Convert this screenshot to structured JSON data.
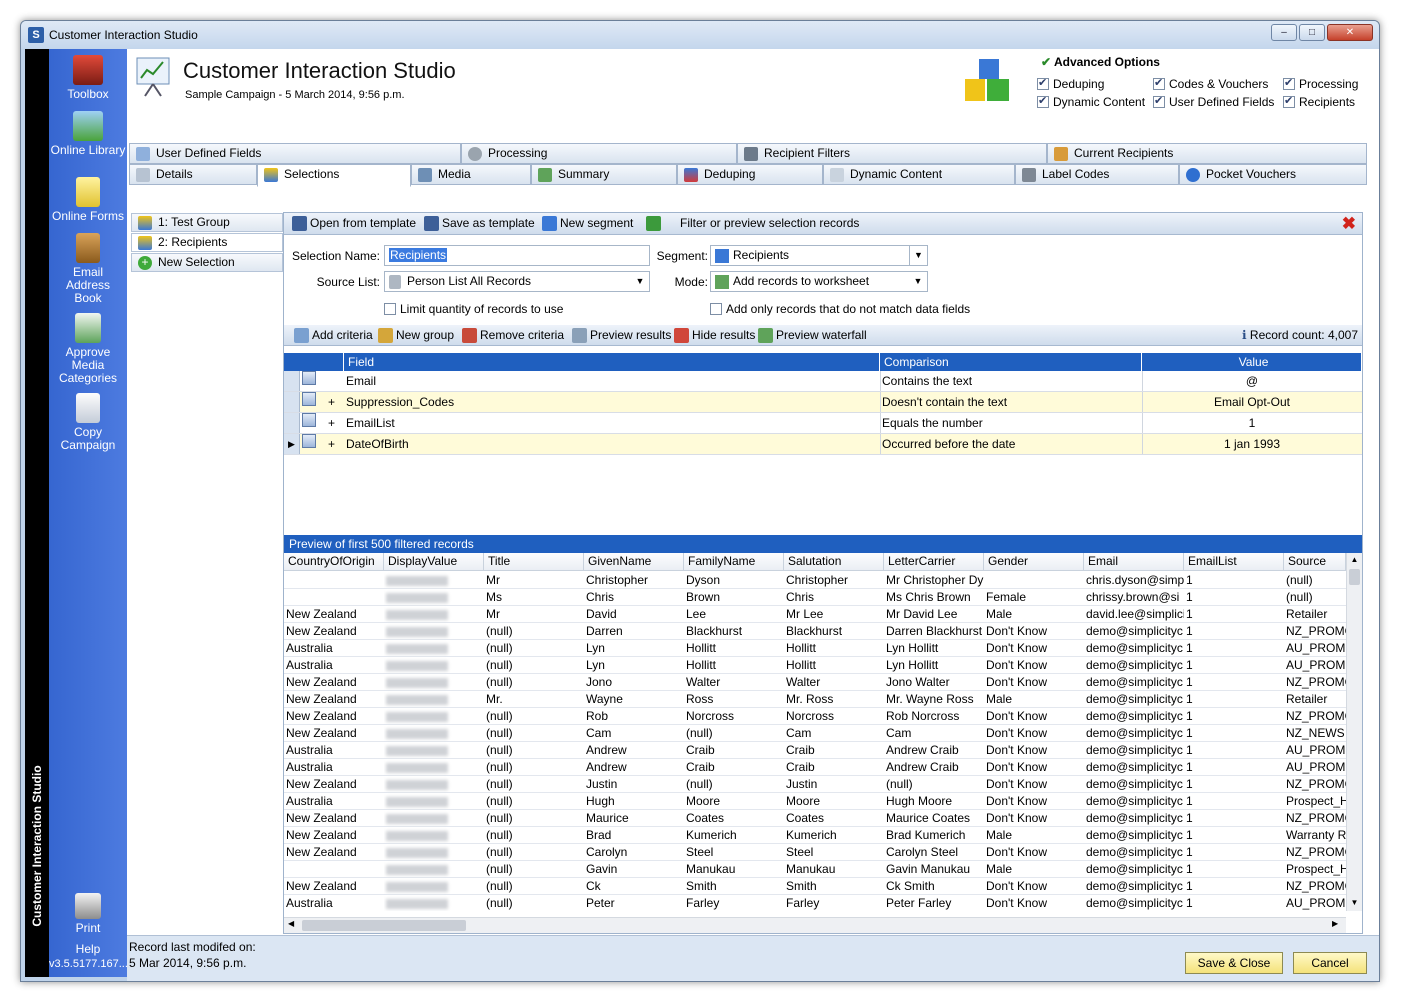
{
  "window": {
    "title": "Customer Interaction Studio"
  },
  "sidebar": {
    "vertical_title": "Customer Interaction Studio",
    "items": [
      "Toolbox",
      "Online Library",
      "Online Forms",
      "Email Address Book",
      "Approve Media Categories",
      "Copy Campaign"
    ],
    "print": "Print",
    "help": "Help",
    "version": "v3.5.5177.167..."
  },
  "header": {
    "title": "Customer Interaction Studio",
    "subtitle": "Sample Campaign - 5 March 2014, 9:56 p.m."
  },
  "advanced": {
    "title": "Advanced Options",
    "options": [
      {
        "label": "Deduping",
        "checked": true
      },
      {
        "label": "Codes & Vouchers",
        "checked": true
      },
      {
        "label": "Processing",
        "checked": true
      },
      {
        "label": "Dynamic Content",
        "checked": true
      },
      {
        "label": "User Defined Fields",
        "checked": true
      },
      {
        "label": "Recipients",
        "checked": true
      }
    ]
  },
  "tabs_top": [
    "User Defined Fields",
    "Processing",
    "Recipient Filters",
    "Current Recipients"
  ],
  "tabs_bottom": [
    "Details",
    "Selections",
    "Media",
    "Summary",
    "Deduping",
    "Dynamic Content",
    "Label Codes",
    "Pocket Vouchers"
  ],
  "selections": [
    "1: Test Group",
    "2: Recipients",
    "New Selection"
  ],
  "toolbar1": {
    "open": "Open from template",
    "save": "Save as template",
    "segment": "New segment",
    "filter": "Filter or preview selection records"
  },
  "form": {
    "name_label": "Selection Name:",
    "name_value": "Recipients",
    "segment_label": "Segment:",
    "segment_value": "Recipients",
    "source_label": "Source List:",
    "source_value": "Person List All Records",
    "mode_label": "Mode:",
    "mode_value": "Add records to worksheet",
    "limit_label": "Limit quantity of records to use",
    "only_label": "Add only records that do not match data fields"
  },
  "toolbar2": {
    "add": "Add criteria",
    "group": "New group",
    "remove": "Remove criteria",
    "preview": "Preview results",
    "hide": "Hide results",
    "waterfall": "Preview waterfall",
    "count": "Record count: 4,007"
  },
  "criteria": {
    "headers": [
      "Field",
      "Comparison",
      "Value"
    ],
    "rows": [
      {
        "plus": "",
        "field": "Email",
        "comparison": "Contains the text",
        "value": "@"
      },
      {
        "plus": "+",
        "field": "Suppression_Codes",
        "comparison": "Doesn't contain the text",
        "value": "Email Opt-Out"
      },
      {
        "plus": "+",
        "field": "EmailList",
        "comparison": "Equals the number",
        "value": "1"
      },
      {
        "plus": "+",
        "field": "DateOfBirth",
        "comparison": "Occurred before the date",
        "value": "1 jan 1993"
      }
    ]
  },
  "preview": {
    "title": "Preview of first 500 filtered records",
    "headers": [
      "CountryOfOrigin",
      "DisplayValue",
      "Title",
      "GivenName",
      "FamilyName",
      "Salutation",
      "LetterCarrier",
      "Gender",
      "Email",
      "EmailList",
      "Source"
    ],
    "rows": [
      [
        "",
        "",
        "Mr",
        "Christopher",
        "Dyson",
        "Christopher",
        "Mr Christopher Dy",
        "",
        "chris.dyson@simp",
        "1",
        "(null)"
      ],
      [
        "",
        "",
        "Ms",
        "Chris",
        "Brown",
        "Chris",
        "Ms Chris Brown",
        "Female",
        "chrissy.brown@si",
        "1",
        "(null)"
      ],
      [
        "New Zealand",
        "",
        "Mr",
        "David",
        "Lee",
        "Mr Lee",
        "Mr David Lee",
        "Male",
        "david.lee@simplici",
        "1",
        "Retailer"
      ],
      [
        "New Zealand",
        "",
        "(null)",
        "Darren",
        "Blackhurst",
        "Blackhurst",
        "Darren Blackhurst",
        "Don't Know",
        "demo@simplicityc",
        "1",
        "NZ_PROMC"
      ],
      [
        "Australia",
        "",
        "(null)",
        "Lyn",
        "Hollitt",
        "Hollitt",
        "Lyn Hollitt",
        "Don't Know",
        "demo@simplicityc",
        "1",
        "AU_PROMC"
      ],
      [
        "Australia",
        "",
        "(null)",
        "Lyn",
        "Hollitt",
        "Hollitt",
        "Lyn Hollitt",
        "Don't Know",
        "demo@simplicityc",
        "1",
        "AU_PROMC"
      ],
      [
        "New Zealand",
        "",
        "(null)",
        "Jono",
        "Walter",
        "Walter",
        "Jono Walter",
        "Don't Know",
        "demo@simplicityc",
        "1",
        "NZ_PROMC"
      ],
      [
        "New Zealand",
        "",
        "Mr.",
        "Wayne",
        "Ross",
        "Mr. Ross",
        "Mr. Wayne Ross",
        "Male",
        "demo@simplicityc",
        "1",
        "Retailer"
      ],
      [
        "New Zealand",
        "",
        "(null)",
        "Rob",
        "Norcross",
        "Norcross",
        "Rob Norcross",
        "Don't Know",
        "demo@simplicityc",
        "1",
        "NZ_PROMC"
      ],
      [
        "New Zealand",
        "",
        "(null)",
        "Cam",
        "(null)",
        "Cam",
        "Cam",
        "Don't Know",
        "demo@simplicityc",
        "1",
        "NZ_NEWS"
      ],
      [
        "Australia",
        "",
        "(null)",
        "Andrew",
        "Craib",
        "Craib",
        "Andrew Craib",
        "Don't Know",
        "demo@simplicityc",
        "1",
        "AU_PROMC"
      ],
      [
        "Australia",
        "",
        "(null)",
        "Andrew",
        "Craib",
        "Craib",
        "Andrew Craib",
        "Don't Know",
        "demo@simplicityc",
        "1",
        "AU_PROMC"
      ],
      [
        "New Zealand",
        "",
        "(null)",
        "Justin",
        "(null)",
        "Justin",
        "(null)",
        "Don't Know",
        "demo@simplicityc",
        "1",
        "NZ_PROMC"
      ],
      [
        "Australia",
        "",
        "(null)",
        "Hugh",
        "Moore",
        "Moore",
        "Hugh Moore",
        "Don't Know",
        "demo@simplicityc",
        "1",
        "Prospect_H"
      ],
      [
        "New Zealand",
        "",
        "(null)",
        "Maurice",
        "Coates",
        "Coates",
        "Maurice Coates",
        "Don't Know",
        "demo@simplicityc",
        "1",
        "NZ_PROMC"
      ],
      [
        "New Zealand",
        "",
        "(null)",
        "Brad",
        "Kumerich",
        "Kumerich",
        "Brad Kumerich",
        "Male",
        "demo@simplicityc",
        "1",
        "Warranty R"
      ],
      [
        "New Zealand",
        "",
        "(null)",
        "Carolyn",
        "Steel",
        "Steel",
        "Carolyn Steel",
        "Don't Know",
        "demo@simplicityc",
        "1",
        "NZ_PROMC"
      ],
      [
        "",
        "",
        "(null)",
        "Gavin",
        "Manukau",
        "Manukau",
        "Gavin Manukau",
        "Male",
        "demo@simplicityc",
        "1",
        "Prospect_H"
      ],
      [
        "New Zealand",
        "",
        "(null)",
        "Ck",
        "Smith",
        "Smith",
        "Ck Smith",
        "Don't Know",
        "demo@simplicityc",
        "1",
        "NZ_PROMC"
      ],
      [
        "Australia",
        "",
        "(null)",
        "Peter",
        "Farley",
        "Farley",
        "Peter Farley",
        "Don't Know",
        "demo@simplicityc",
        "1",
        "AU_PROMC"
      ]
    ]
  },
  "footer": {
    "modified_label": "Record last modifed on:",
    "modified_value": "5 Mar 2014, 9:56 p.m.",
    "save": "Save & Close",
    "cancel": "Cancel"
  }
}
